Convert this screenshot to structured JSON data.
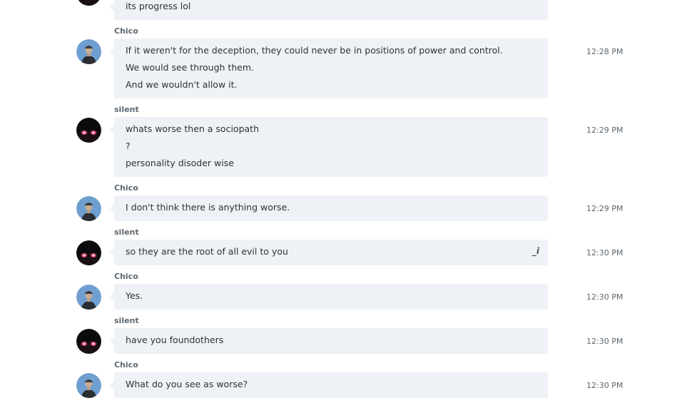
{
  "colors": {
    "bubble_bg": "#eef1f6",
    "sender_text": "#5c6770",
    "message_text": "#2e3338",
    "time_text": "#5c6770"
  },
  "messages": [
    {
      "sender": "",
      "avatar": "silent-avatar-icon",
      "lines": [
        "its progress lol"
      ],
      "time": ""
    },
    {
      "sender": "Chico",
      "avatar": "chico-avatar-icon",
      "lines": [
        "If it weren't for the deception, they could never be in positions of power and control.",
        "We would see through them.",
        "And we wouldn't allow it."
      ],
      "time": "12:28 PM"
    },
    {
      "sender": "silent",
      "avatar": "silent-avatar-icon",
      "lines": [
        "whats worse then a sociopath",
        "?",
        "personality disoder wise"
      ],
      "time": "12:29 PM"
    },
    {
      "sender": "Chico",
      "avatar": "chico-avatar-icon",
      "lines": [
        "I don't think there is anything worse."
      ],
      "time": "12:29 PM"
    },
    {
      "sender": "silent",
      "avatar": "silent-avatar-icon",
      "lines": [
        "so they are the root of all evil to you"
      ],
      "time": "12:30 PM",
      "edited_icon": "edited-pencil-icon"
    },
    {
      "sender": "Chico",
      "avatar": "chico-avatar-icon",
      "lines": [
        "Yes."
      ],
      "time": "12:30 PM"
    },
    {
      "sender": "silent",
      "avatar": "silent-avatar-icon",
      "lines": [
        "have you foundothers"
      ],
      "time": "12:30 PM"
    },
    {
      "sender": "Chico",
      "avatar": "chico-avatar-icon",
      "lines": [
        "What do you see as worse?"
      ],
      "time": "12:30 PM"
    }
  ]
}
